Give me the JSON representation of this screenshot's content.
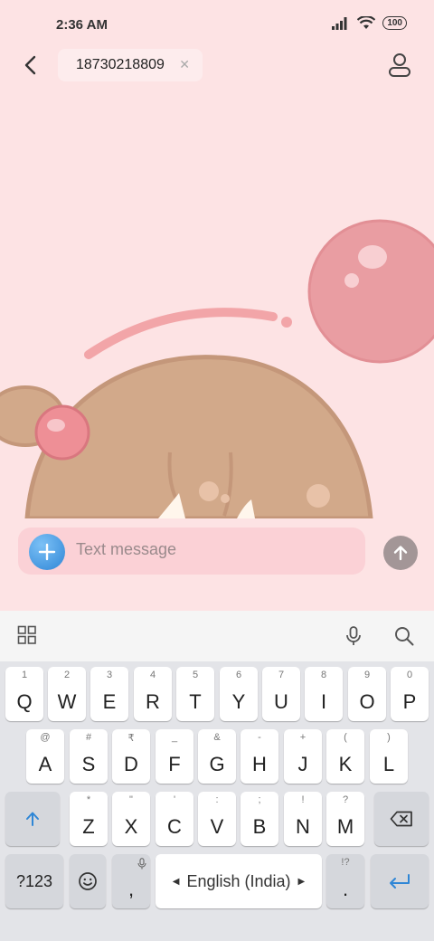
{
  "status_bar": {
    "time": "2:36 AM",
    "battery": "100"
  },
  "header": {
    "recipient": "18730218809"
  },
  "compose": {
    "placeholder": "Text message"
  },
  "keyboard": {
    "row1": [
      {
        "main": "Q",
        "sub": "1"
      },
      {
        "main": "W",
        "sub": "2"
      },
      {
        "main": "E",
        "sub": "3"
      },
      {
        "main": "R",
        "sub": "4"
      },
      {
        "main": "T",
        "sub": "5"
      },
      {
        "main": "Y",
        "sub": "6"
      },
      {
        "main": "U",
        "sub": "7"
      },
      {
        "main": "I",
        "sub": "8"
      },
      {
        "main": "O",
        "sub": "9"
      },
      {
        "main": "P",
        "sub": "0"
      }
    ],
    "row2": [
      {
        "main": "A",
        "sub": "@"
      },
      {
        "main": "S",
        "sub": "#"
      },
      {
        "main": "D",
        "sub": "₹"
      },
      {
        "main": "F",
        "sub": "_"
      },
      {
        "main": "G",
        "sub": "&"
      },
      {
        "main": "H",
        "sub": "-"
      },
      {
        "main": "J",
        "sub": "+"
      },
      {
        "main": "K",
        "sub": "("
      },
      {
        "main": "L",
        "sub": ")"
      }
    ],
    "row3": [
      {
        "main": "Z",
        "sub": "*"
      },
      {
        "main": "X",
        "sub": "\""
      },
      {
        "main": "C",
        "sub": "'"
      },
      {
        "main": "V",
        "sub": ":"
      },
      {
        "main": "B",
        "sub": ";"
      },
      {
        "main": "N",
        "sub": "!"
      },
      {
        "main": "M",
        "sub": "?"
      }
    ],
    "symbols_label": "?123",
    "comma": ",",
    "space_label": "English (India)",
    "period": ".",
    "period_sub": "!?"
  },
  "colors": {
    "background": "#fde3e4",
    "compose_field": "#fbd1d6",
    "accent_blue": "#2f86d6",
    "keyboard_bg": "#e3e4e8"
  }
}
